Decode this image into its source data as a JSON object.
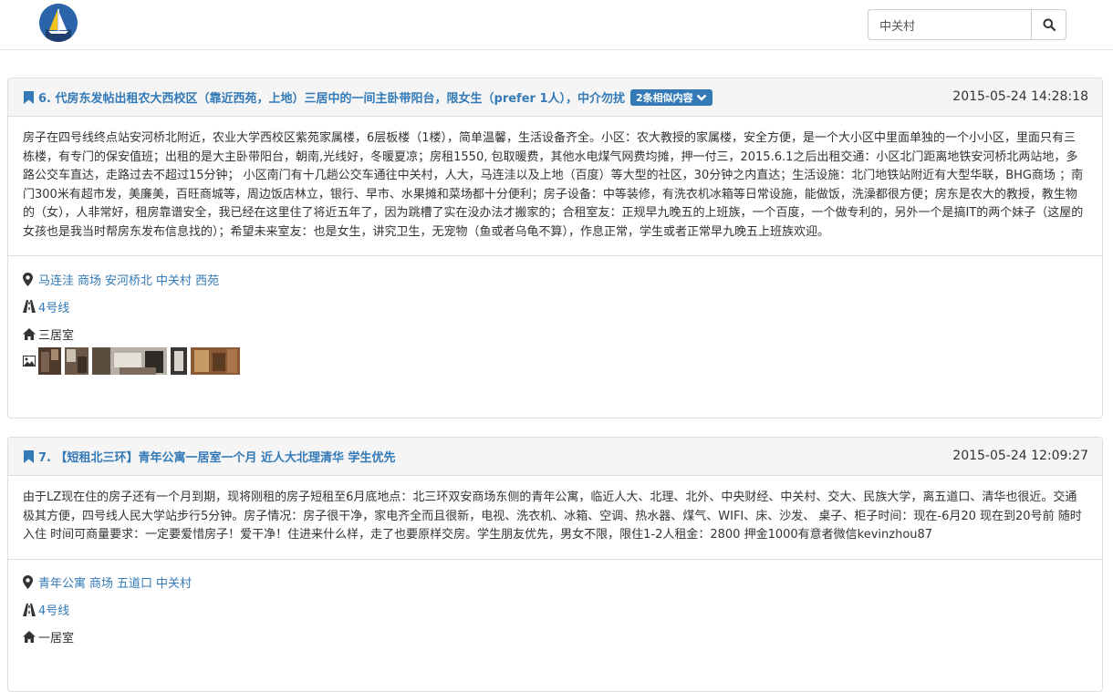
{
  "search": {
    "value": "中关村"
  },
  "posts": [
    {
      "title": "6. 代房东发帖出租农大西校区（靠近西苑，上地）三居中的一间主卧带阳台，限女生（prefer 1人），中介勿扰",
      "similar_badge": "2条相似内容",
      "date": "2015-05-24 14:28:18",
      "body": "房子在四号线终点站安河桥北附近，农业大学西校区紫苑家属楼，6层板楼（1楼），简单温馨，生活设备齐全。小区：农大教授的家属楼，安全方便，是一个大小区中里面单独的一个小小区，里面只有三栋楼，有专门的保安值班；出租的是大主卧带阳台，朝南,光线好，冬暖夏凉；房租1550, 包取暖费，其他水电煤气网费均摊，押一付三，2015.6.1之后出租交通：小区北门距离地铁安河桥北两站地，多路公交车直达，走路过去不超过15分钟； 小区南门有十几趟公交车通往中关村，人大，马连洼以及上地（百度）等大型的社区，30分钟之内直达；生活设施：北门地铁站附近有大型华联，BHG商场 ；南门300米有超市发，美廉美，百旺商城等，周边饭店林立，银行、早市、水果摊和菜场都十分便利；房子设备：中等装修，有洗衣机冰箱等日常设施，能做饭，洗澡都很方便；房东是农大的教授，教生物的（女），人非常好，租房靠谱安全，我已经在这里住了将近五年了，因为跳槽了实在没办法才搬家的；合租室友：正规早九晚五的上班族，一个百度，一个做专利的，另外一个是搞IT的两个妹子（这屋的女孩也是我当时帮房东发布信息找的）；希望未来室友：也是女生，讲究卫生，无宠物（鱼或者乌龟不算），作息正常，学生或者正常早九晚五上班族欢迎。",
      "locations": [
        "马连洼",
        "商场",
        "安河桥北",
        "中关村",
        "西苑"
      ],
      "subway": "4号线",
      "room": "三居室"
    },
    {
      "title": "7. 【短租北三环】青年公寓一居室一个月 近人大北理清华 学生优先",
      "date": "2015-05-24 12:09:27",
      "body": "由于LZ现在住的房子还有一个月到期，现将刚租的房子短租至6月底地点：北三环双安商场东侧的青年公寓，临近人大、北理、北外、中央财经、中关村、交大、民族大学，离五道口、清华也很近。交通极其方便，四号线人民大学站步行5分钟。房子情况：房子很干净，家电齐全而且很新，电视、洗衣机、冰箱、空调、热水器、煤气、WIFI、床、沙发、 桌子、柜子时间：现在-6月20 现在到20号前 随时入住 时间可商量要求：一定要爱惜房子！爱干净！住进来什么样，走了也要原样交房。学生朋友优先，男女不限，限住1-2人租金：2800 押金1000有意者微信kevinzhou87",
      "locations": [
        "青年公寓",
        "商场",
        "五道口",
        "中关村"
      ],
      "subway": "4号线",
      "room": "一居室"
    }
  ],
  "colors": {
    "link": "#337ab7",
    "panel_heading": "#f5f5f5",
    "border": "#dddddd"
  },
  "icons": [
    "logo-icon",
    "search-icon",
    "bookmark-icon",
    "chevron-down-icon",
    "map-marker-icon",
    "road-icon",
    "home-icon",
    "picture-icon"
  ]
}
